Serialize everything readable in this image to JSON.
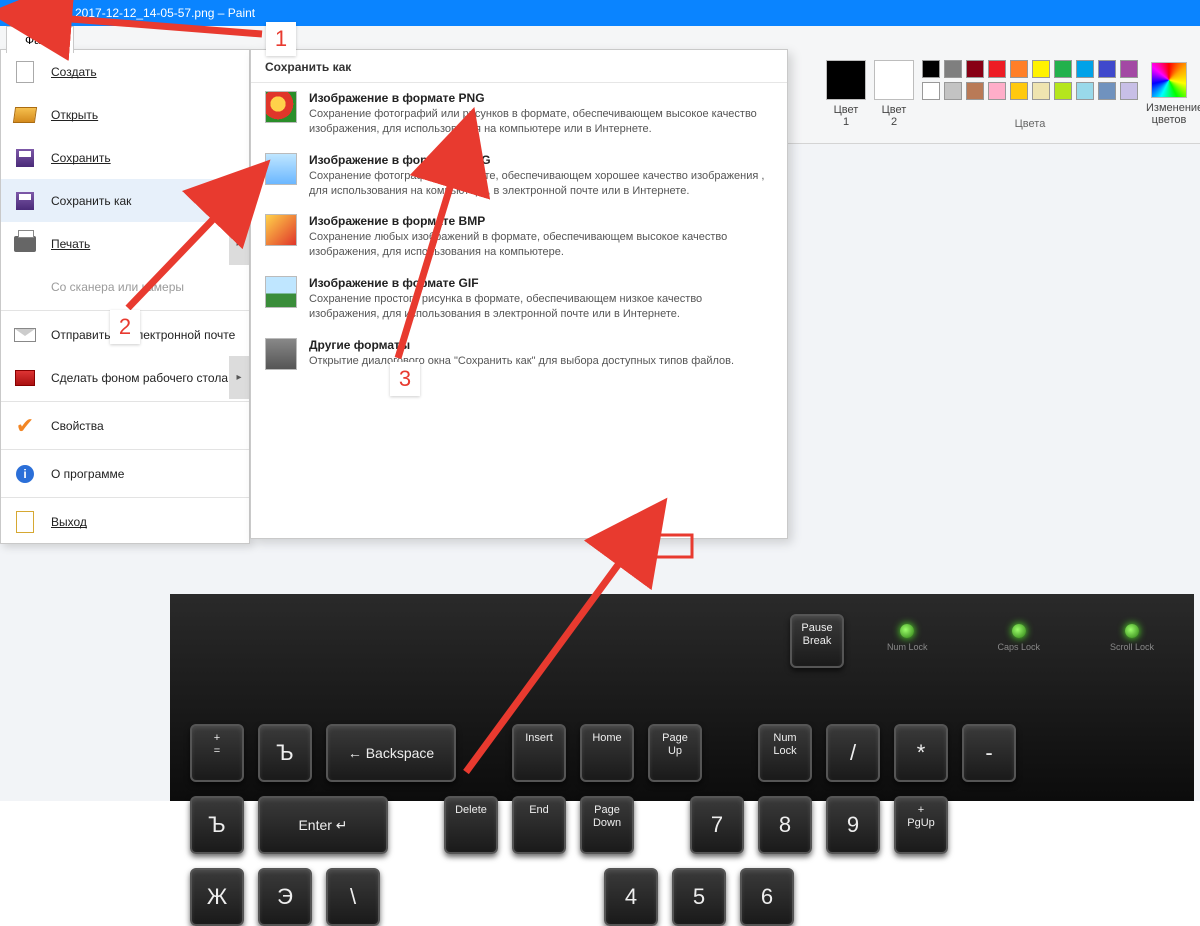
{
  "title_bar": {
    "document": "2017-12-12_14-05-57.png – Paint"
  },
  "file_tab": "Файл",
  "file_menu": {
    "create": "Создать",
    "open": "Открыть",
    "save": "Сохранить",
    "save_as": "Сохранить как",
    "print": "Печать",
    "scanner": "Со сканера или камеры",
    "send_mail": "Отправить по электронной почте",
    "set_wall": "Сделать фоном рабочего стола",
    "props": "Свойства",
    "about": "О программе",
    "exit": "Выход"
  },
  "save_as_panel": {
    "header": "Сохранить как",
    "png_title": "Изображение в формате PNG",
    "png_desc": "Сохранение фотографий или рисунков в формате, обеспечивающем высокое качество изображения, для использования на компьютере или в Интернете.",
    "jpeg_title": "Изображение в формате JPEG",
    "jpeg_desc": "Сохранение фотографий в формате, обеспечивающем хорошее качество изображения , для использования на компьютере, в электронной почте или в Интернете.",
    "bmp_title": "Изображение в формате BMP",
    "bmp_desc": "Сохранение любых изображений в формате, обеспечивающем высокое качество изображения, для использования на компьютере.",
    "gif_title": "Изображение в формате GIF",
    "gif_desc": "Сохранение простого рисунка в формате, обеспечивающем низкое качество изображения, для использования в электронной почте или в Интернете.",
    "other_title": "Другие форматы",
    "other_desc": "Открытие диалогового окна \"Сохранить как\" для выбора доступных типов файлов."
  },
  "ribbon": {
    "color1": "Цвет\n1",
    "color2": "Цвет\n2",
    "colors_group": "Цвета",
    "edit_colors": "Изменение\nцветов",
    "palette": [
      "#000000",
      "#7f7f7f",
      "#880015",
      "#ed1c24",
      "#ff7f27",
      "#fff200",
      "#22b14c",
      "#00a2e8",
      "#3f48cc",
      "#a349a4",
      "#ffffff",
      "#c3c3c3",
      "#b97a57",
      "#ffaec9",
      "#ffc90e",
      "#efe4b0",
      "#b5e61d",
      "#99d9ea",
      "#7092be",
      "#c8bfe7"
    ]
  },
  "callouts": {
    "c1": "1",
    "c2": "2",
    "c3": "3"
  },
  "keyboard": {
    "leds": [
      "Num Lock",
      "Caps Lock",
      "Scroll Lock"
    ],
    "pause": "Pause\nBreak",
    "row1": [
      "+\n=",
      "Ъ",
      "← Backspace",
      "",
      "Insert",
      "Home",
      "Page\nUp",
      "",
      "Num\nLock",
      "/",
      "*",
      "-"
    ],
    "row2": [
      "Ъ",
      "Enter ↵",
      "",
      "Delete",
      "End",
      "Page\nDown",
      "",
      "7",
      "8",
      "9",
      "+\nPgUp"
    ],
    "row3": [
      "Ж",
      "Э",
      "\\",
      "",
      "",
      "",
      "",
      "",
      "4",
      "5",
      "6"
    ]
  }
}
